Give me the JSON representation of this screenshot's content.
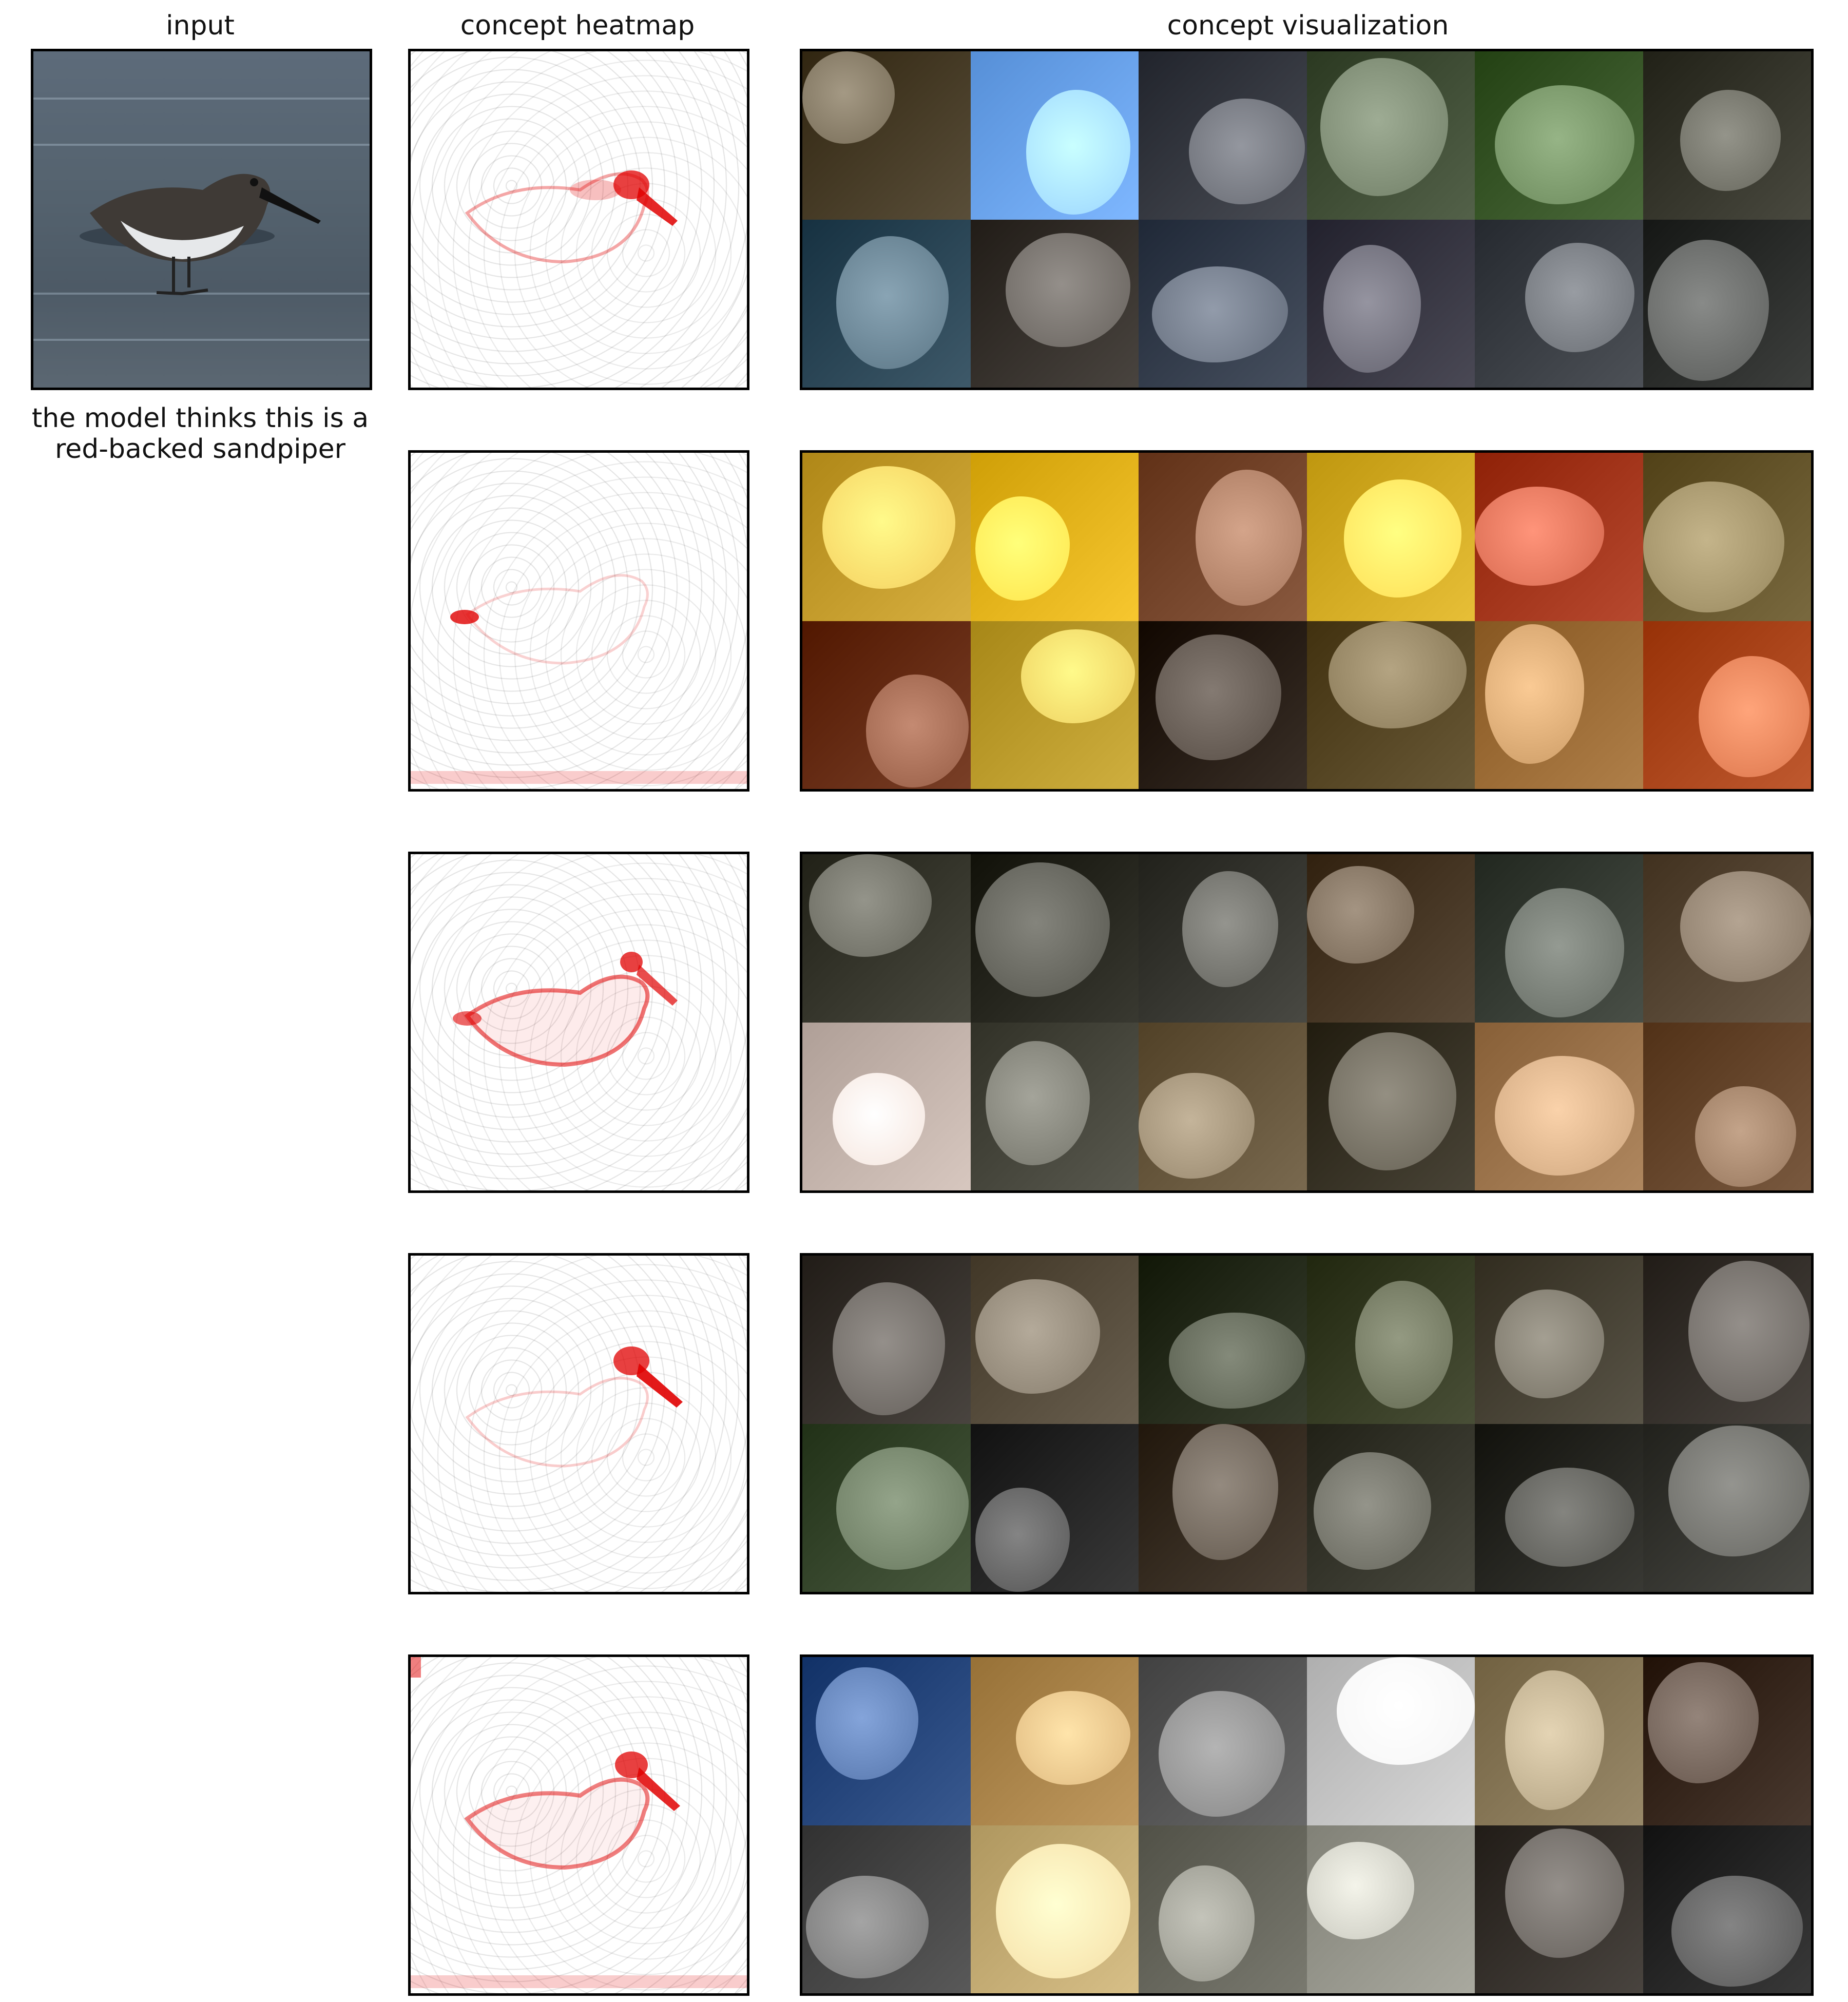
{
  "column_titles": {
    "input": "input",
    "heatmap": "concept heatmap",
    "visualization": "concept visualization"
  },
  "caption": {
    "line1": "the model thinks this is a",
    "line2": "red-backed sandpiper"
  },
  "colors": {
    "heat_red": "#e00000",
    "frame": "#000000"
  },
  "concepts": [
    {
      "tiles": [
        "#4a3f2a",
        "#6fa8f0",
        "#3a3d45",
        "#44523a",
        "#3c5a2c",
        "#3a3a30",
        "#2f4a5a",
        "#3a3530",
        "#384150",
        "#3b3a46",
        "#3e4248",
        "#2e302e"
      ]
    },
    {
      "tiles": [
        "#c8a030",
        "#e8b820",
        "#7a4a30",
        "#d8b028",
        "#a83a20",
        "#6a5a30",
        "#6a3018",
        "#c0a030",
        "#2a2018",
        "#5a4a28",
        "#a0703a",
        "#b04a20"
      ]
    },
    {
      "tiles": [
        "#3a3a30",
        "#2a2a22",
        "#3a3a34",
        "#4a3a28",
        "#3a4038",
        "#5a4a38",
        "#c8b8b0",
        "#4a4a40",
        "#6a5a40",
        "#3a3528",
        "#a07850",
        "#6a4a30"
      ]
    },
    {
      "tiles": [
        "#3a3530",
        "#5a5040",
        "#2a3020",
        "#3a4028",
        "#4a4538",
        "#3a3530",
        "#3a4a30",
        "#2a2a2a",
        "#3a3025",
        "#3a3a30",
        "#2a2a25",
        "#3a3a35"
      ]
    },
    {
      "tiles": [
        "#2a4a80",
        "#b08a50",
        "#5a5a5a",
        "#c8c8c8",
        "#8a7a5a",
        "#3a2a20",
        "#4a4a4a",
        "#c8b078",
        "#6a6a60",
        "#9a9a90",
        "#3a3530",
        "#2a2a2a"
      ]
    }
  ]
}
